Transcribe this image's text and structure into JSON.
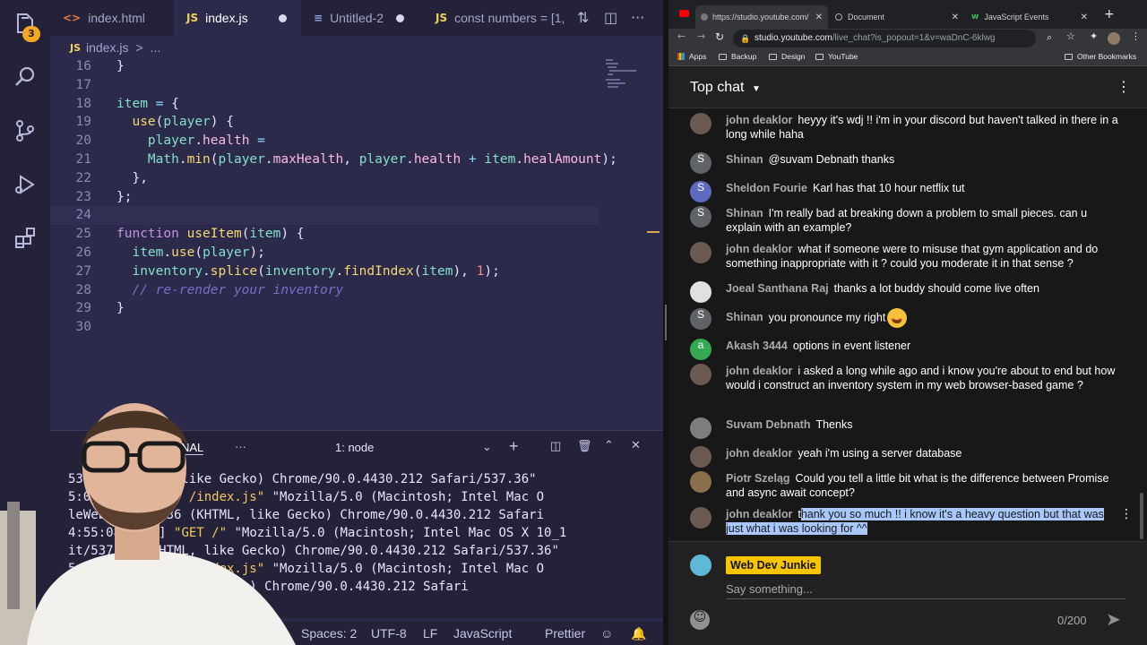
{
  "colors": {
    "editor_bg": "#2b2a4a",
    "activity_bg": "#232238",
    "chat_bg": "#181818",
    "selection": "#a8c7fa",
    "member_badge": "#f7c500"
  },
  "activity_bar": {
    "badge_count": "3",
    "icons": [
      "files-icon",
      "search-icon",
      "source-control-icon",
      "run-debug-icon",
      "extensions-icon",
      "account-icon"
    ]
  },
  "editor_tabs": [
    {
      "label": "index.html",
      "icon": "html-file-icon",
      "icon_text": "<>"
    },
    {
      "label": "index.js",
      "icon": "js-file-icon",
      "icon_text": "JS",
      "modified": true,
      "active": true
    },
    {
      "label": "Untitled-2",
      "icon": "file-icon",
      "icon_text": "≡",
      "modified": true
    },
    {
      "label": "const numbers = [1,",
      "icon": "js-file-icon",
      "icon_text": "JS"
    }
  ],
  "breadcrumb": {
    "file_icon": "JS",
    "file": "index.js",
    "separator": ">",
    "trail": "..."
  },
  "code_lines": [
    {
      "n": "16",
      "html": "}"
    },
    {
      "n": "17",
      "html": ""
    },
    {
      "n": "18",
      "html": "<span class=\"v\">item</span> <span class=\"o\">=</span> {"
    },
    {
      "n": "19",
      "html": "  <span class=\"f\">use</span>(<span class=\"v\">player</span>) {"
    },
    {
      "n": "20",
      "html": "    <span class=\"v\">player</span>.<span class=\"p\">health</span> <span class=\"o\">=</span>"
    },
    {
      "n": "21",
      "html": "    <span class=\"v\">Math</span>.<span class=\"f\">min</span>(<span class=\"v\">player</span>.<span class=\"p\">maxHealth</span>, <span class=\"v\">player</span>.<span class=\"p\">health</span> <span class=\"o\">+</span> <span class=\"v\">item</span>.<span class=\"p\">healAmount</span>);"
    },
    {
      "n": "22",
      "html": "  },"
    },
    {
      "n": "23",
      "html": "};"
    },
    {
      "n": "24",
      "html": "",
      "current": true
    },
    {
      "n": "25",
      "html": "<span class=\"k\">function</span> <span class=\"f\">useItem</span>(<span class=\"v\">item</span>) {"
    },
    {
      "n": "26",
      "html": "  <span class=\"v\">item</span>.<span class=\"f\">use</span>(<span class=\"v\">player</span>);"
    },
    {
      "n": "27",
      "html": "  <span class=\"v\">inventory</span>.<span class=\"f\">splice</span>(<span class=\"v\">inventory</span>.<span class=\"f\">findIndex</span>(<span class=\"v\">item</span>), <span class=\"n\">1</span>);"
    },
    {
      "n": "28",
      "html": "  <span class=\"c\">// re-render your inventory</span>"
    },
    {
      "n": "29",
      "html": "}"
    },
    {
      "n": "30",
      "html": ""
    }
  ],
  "terminal": {
    "tab_label": "NAL",
    "more": "···",
    "node_select": "1: node",
    "output_html": "537.36 (KHTML, like Gecko) Chrome/90.0.4430.212 Safari/537.36\"\n5:03.972Z] <span class=\"str\">\"GET /index.js\"</span> \"Mozilla/5.0 (Macintosh; Intel Mac O\nleWebKit/537.36 (KHTML, like Gecko) Chrome/90.0.4430.212 Safari\n4:55:08.605Z] <span class=\"str\">\"GET /\"</span> \"Mozilla/5.0 (Macintosh; Intel Mac OS X 10_1\nit/537.36 (KHTML, like Gecko) Chrome/90.0.4430.212 Safari/537.36\"\n5:08.628Z] <span class=\"str\">\"GET /index.js\"</span> \"Mozilla/5.0 (Macintosh; Intel Mac O\n37.36 (KHTML, like Gecko) Chrome/90.0.4430.212 Safari"
  },
  "status_bar": {
    "spaces": "Spaces: 2",
    "encoding": "UTF-8",
    "eol": "LF",
    "language": "JavaScript",
    "formatter": "Prettier"
  },
  "browser": {
    "tabs": [
      {
        "label": "https://studio.youtube.com/",
        "active": true
      },
      {
        "label": "Document"
      },
      {
        "label": "JavaScript Events"
      }
    ],
    "new_tab": "+",
    "url_host": "studio.youtube.com",
    "url_path": "/live_chat?is_popout=1&v=waDnC-6klwg",
    "bookmarks": [
      "Apps",
      "Backup",
      "Design",
      "YouTube"
    ],
    "other_bookmarks": "Other Bookmarks"
  },
  "chat": {
    "title": "Top chat",
    "messages": [
      {
        "author": "john deaklor",
        "text": "heyyy it's wdj !! i'm in your discord but haven't talked in there in a long while haha",
        "avatar": "photo",
        "color": "#6b5a52"
      },
      {
        "author": "Shinan",
        "text": "@suvam Debnath thanks",
        "avatar": "S",
        "color": "#5f6368"
      },
      {
        "author": "Sheldon Fourie",
        "text": "Karl has that 10 hour netflix tut",
        "avatar": "S",
        "color": "#5c6bc0"
      },
      {
        "author": "Shinan",
        "text": "I'm really bad at breaking down a problem to small pieces. can u explain with an example?",
        "avatar": "S",
        "color": "#5f6368"
      },
      {
        "author": "john deaklor",
        "text": "what if someone were to misuse that gym application and do something inappropriate with it ? could you moderate it in that sense ?",
        "avatar": "photo",
        "color": "#6b5a52"
      },
      {
        "author": "Joeal Santhana Raj",
        "text": "thanks a lot buddy should come live often",
        "avatar": "photo",
        "color": "#e0e0e0"
      },
      {
        "author": "Shinan",
        "text": "you pronounce my right",
        "avatar": "S",
        "color": "#5f6368",
        "emoji": true
      },
      {
        "author": "Akash 3444",
        "text": "options in event listener",
        "avatar": "a",
        "color": "#34a853"
      },
      {
        "author": "john deaklor",
        "text": "i asked a long while ago and i know you're about to end but how would i construct an inventory system in my web browser-based game ?",
        "avatar": "photo",
        "color": "#6b5a52"
      },
      {
        "author": "Suvam Debnath",
        "text": "Thenks",
        "avatar": "photo",
        "color": "#7d7d7d"
      },
      {
        "author": "john deaklor",
        "text": "yeah i'm using a server database",
        "avatar": "photo",
        "color": "#6b5a52"
      },
      {
        "author": "Piotr Szeląg",
        "text": "Could you tell a little bit what is the difference between Promise and async await concept?",
        "avatar": "photo",
        "color": "#8a6f4c"
      },
      {
        "author": "john deaklor",
        "text_plain": "t",
        "text_selected": "hank you so much !! i know it's a heavy question but that was just what i was looking for ^^",
        "avatar": "photo",
        "color": "#6b5a52"
      }
    ],
    "input": {
      "member_name": "Web Dev Junkie",
      "placeholder": "Say something...",
      "counter": "0/200"
    }
  }
}
